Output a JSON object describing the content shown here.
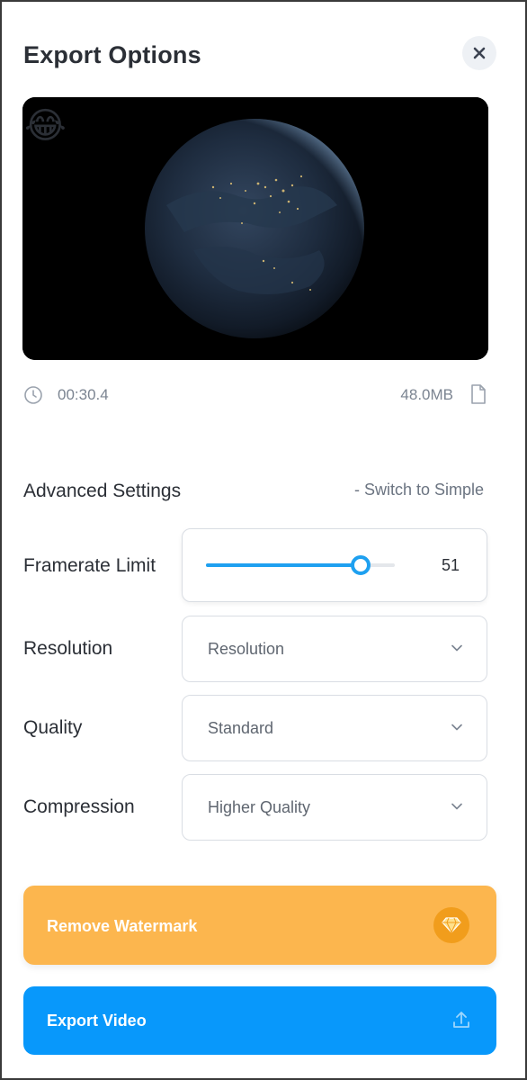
{
  "dialog": {
    "title": "Export Options",
    "close_icon": "close-icon"
  },
  "preview": {
    "overlay_emoji": "😂",
    "content": "earth-at-night-globe"
  },
  "meta": {
    "duration": "00:30.4",
    "file_size": "48.0MB",
    "duration_icon": "clock-icon",
    "file_icon": "file-icon"
  },
  "advanced": {
    "title": "Advanced Settings",
    "switch_link": "- Switch to Simple"
  },
  "settings": {
    "framerate": {
      "label": "Framerate Limit",
      "value": "51",
      "slider_fraction": 0.82
    },
    "resolution": {
      "label": "Resolution",
      "value": "Resolution"
    },
    "quality": {
      "label": "Quality",
      "value": "Standard"
    },
    "compression": {
      "label": "Compression",
      "value": "Higher Quality"
    }
  },
  "buttons": {
    "remove_watermark": "Remove Watermark",
    "export_video": "Export Video",
    "watermark_icon": "gem-icon",
    "export_icon": "upload-icon"
  },
  "colors": {
    "accent": "#1ea0f0",
    "watermark_button": "#fcb64e",
    "export_button": "#0898fb"
  }
}
